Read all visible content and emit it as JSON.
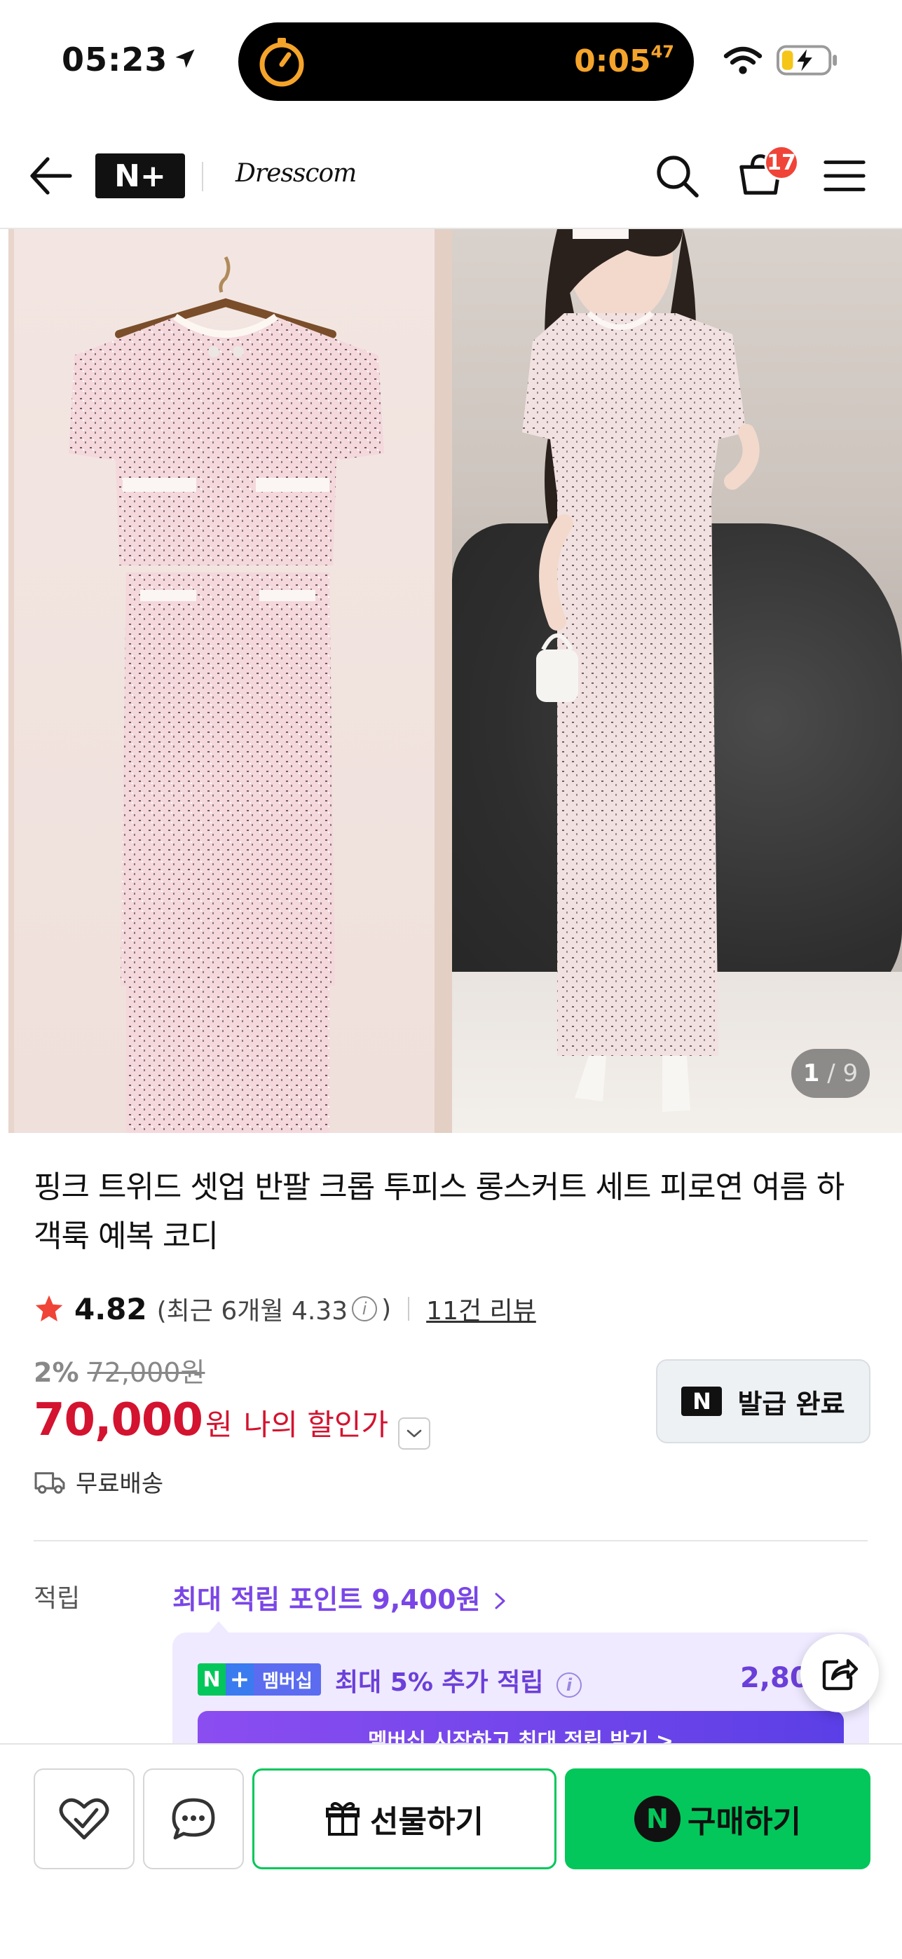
{
  "status_bar": {
    "time": "05:23",
    "timer_main": "0:05",
    "timer_sub": "47"
  },
  "header": {
    "logo": "N+",
    "store_name": "Dresscom",
    "cart_count": "17"
  },
  "gallery": {
    "current": "1",
    "total": "9"
  },
  "product": {
    "title": "핑크 트위드 셋업 반팔 크롭 투피스 롱스커트 세트 피로연 여름 하객룩 예복 코디",
    "rating": "4.82",
    "recent_rating_open": "(최근 6개월 4.33",
    "recent_rating_close": ")",
    "review_count": "11건 리뷰",
    "discount_rate": "2%",
    "original_price": "72,000원",
    "price": "70,000",
    "price_unit": "원",
    "my_discount_label": "나의 할인가",
    "coupon_label": "발급 완료",
    "coupon_icon_text": "N",
    "shipping": "무료배송"
  },
  "points": {
    "label": "적립",
    "max_points": "최대 적립 포인트 9,400원",
    "membership_badge_n": "N",
    "membership_badge_plus": "+",
    "membership_badge_text": "멤버십",
    "membership_text": "최대 5% 추가 적립",
    "membership_amount": "2,80",
    "cta": "멤버십 시작하고 최대 적립 받기 >"
  },
  "bottom_bar": {
    "gift_label": "선물하기",
    "buy_label": "구매하기",
    "npay_icon": "N"
  },
  "colors": {
    "brand_green": "#03c75a",
    "price_red": "#d3132f",
    "purple": "#7a46e6",
    "badge_red": "#f04438"
  }
}
